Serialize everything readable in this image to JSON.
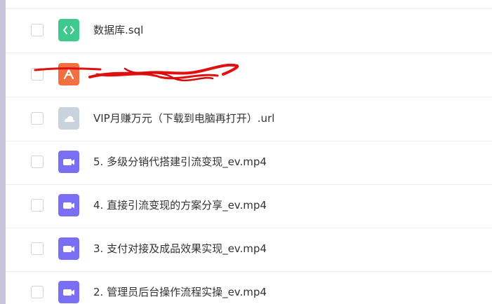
{
  "file_list": {
    "items": [
      {
        "name": "数据库.sql",
        "icon": "code-file-icon",
        "color": "#3ec98e"
      },
      {
        "name": "",
        "icon": "document-file-icon",
        "color": "#f0713f",
        "redacted": true
      },
      {
        "name": "VIP月赚万元（下载到电脑再打开）.url",
        "icon": "link-file-icon",
        "color": "#c9d3de"
      },
      {
        "name": "5. 多级分销代搭建引流变现_ev.mp4",
        "icon": "video-file-icon",
        "color": "#7a6ef2"
      },
      {
        "name": "4. 直接引流变现的方案分享_ev.mp4",
        "icon": "video-file-icon",
        "color": "#7a6ef2"
      },
      {
        "name": "3. 支付对接及成品效果实现_ev.mp4",
        "icon": "video-file-icon",
        "color": "#7a6ef2"
      },
      {
        "name": "2. 管理员后台操作流程实操_ev.mp4",
        "icon": "video-file-icon",
        "color": "#7a6ef2"
      }
    ]
  }
}
